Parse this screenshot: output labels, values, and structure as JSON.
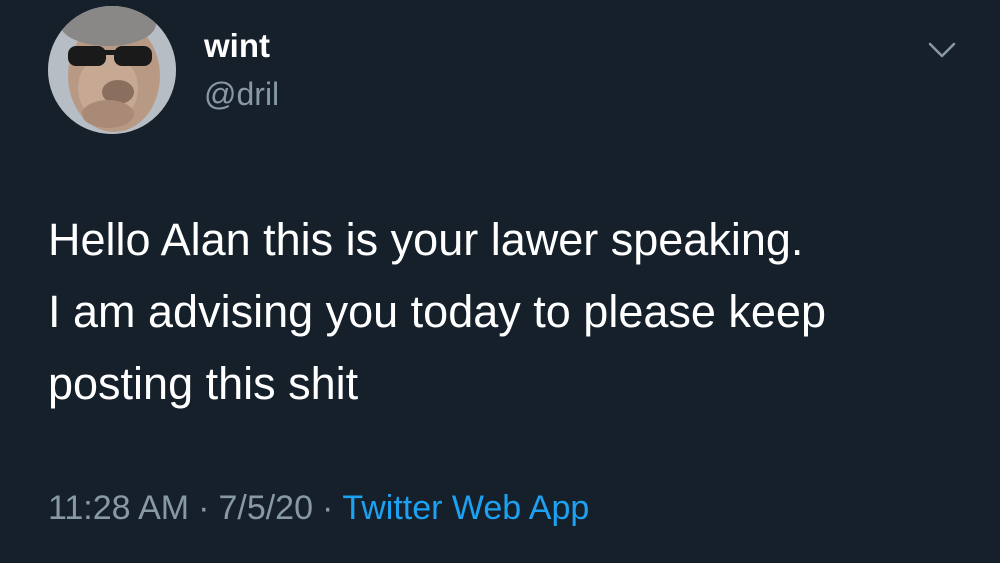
{
  "author": {
    "display_name": "wint",
    "handle": "@dril"
  },
  "tweet": {
    "lines": [
      "Hello Alan this is your lawer speaking.",
      "I am advising you today to please keep",
      "posting this shit"
    ]
  },
  "meta": {
    "time": "11:28 AM",
    "separator": "·",
    "date": "7/5/20",
    "source": "Twitter Web App"
  },
  "icons": {
    "menu": "chevron-down-icon"
  },
  "colors": {
    "background": "#15202b",
    "primary_text": "#ffffff",
    "secondary_text": "#8899a6",
    "link": "#1da1f2"
  }
}
